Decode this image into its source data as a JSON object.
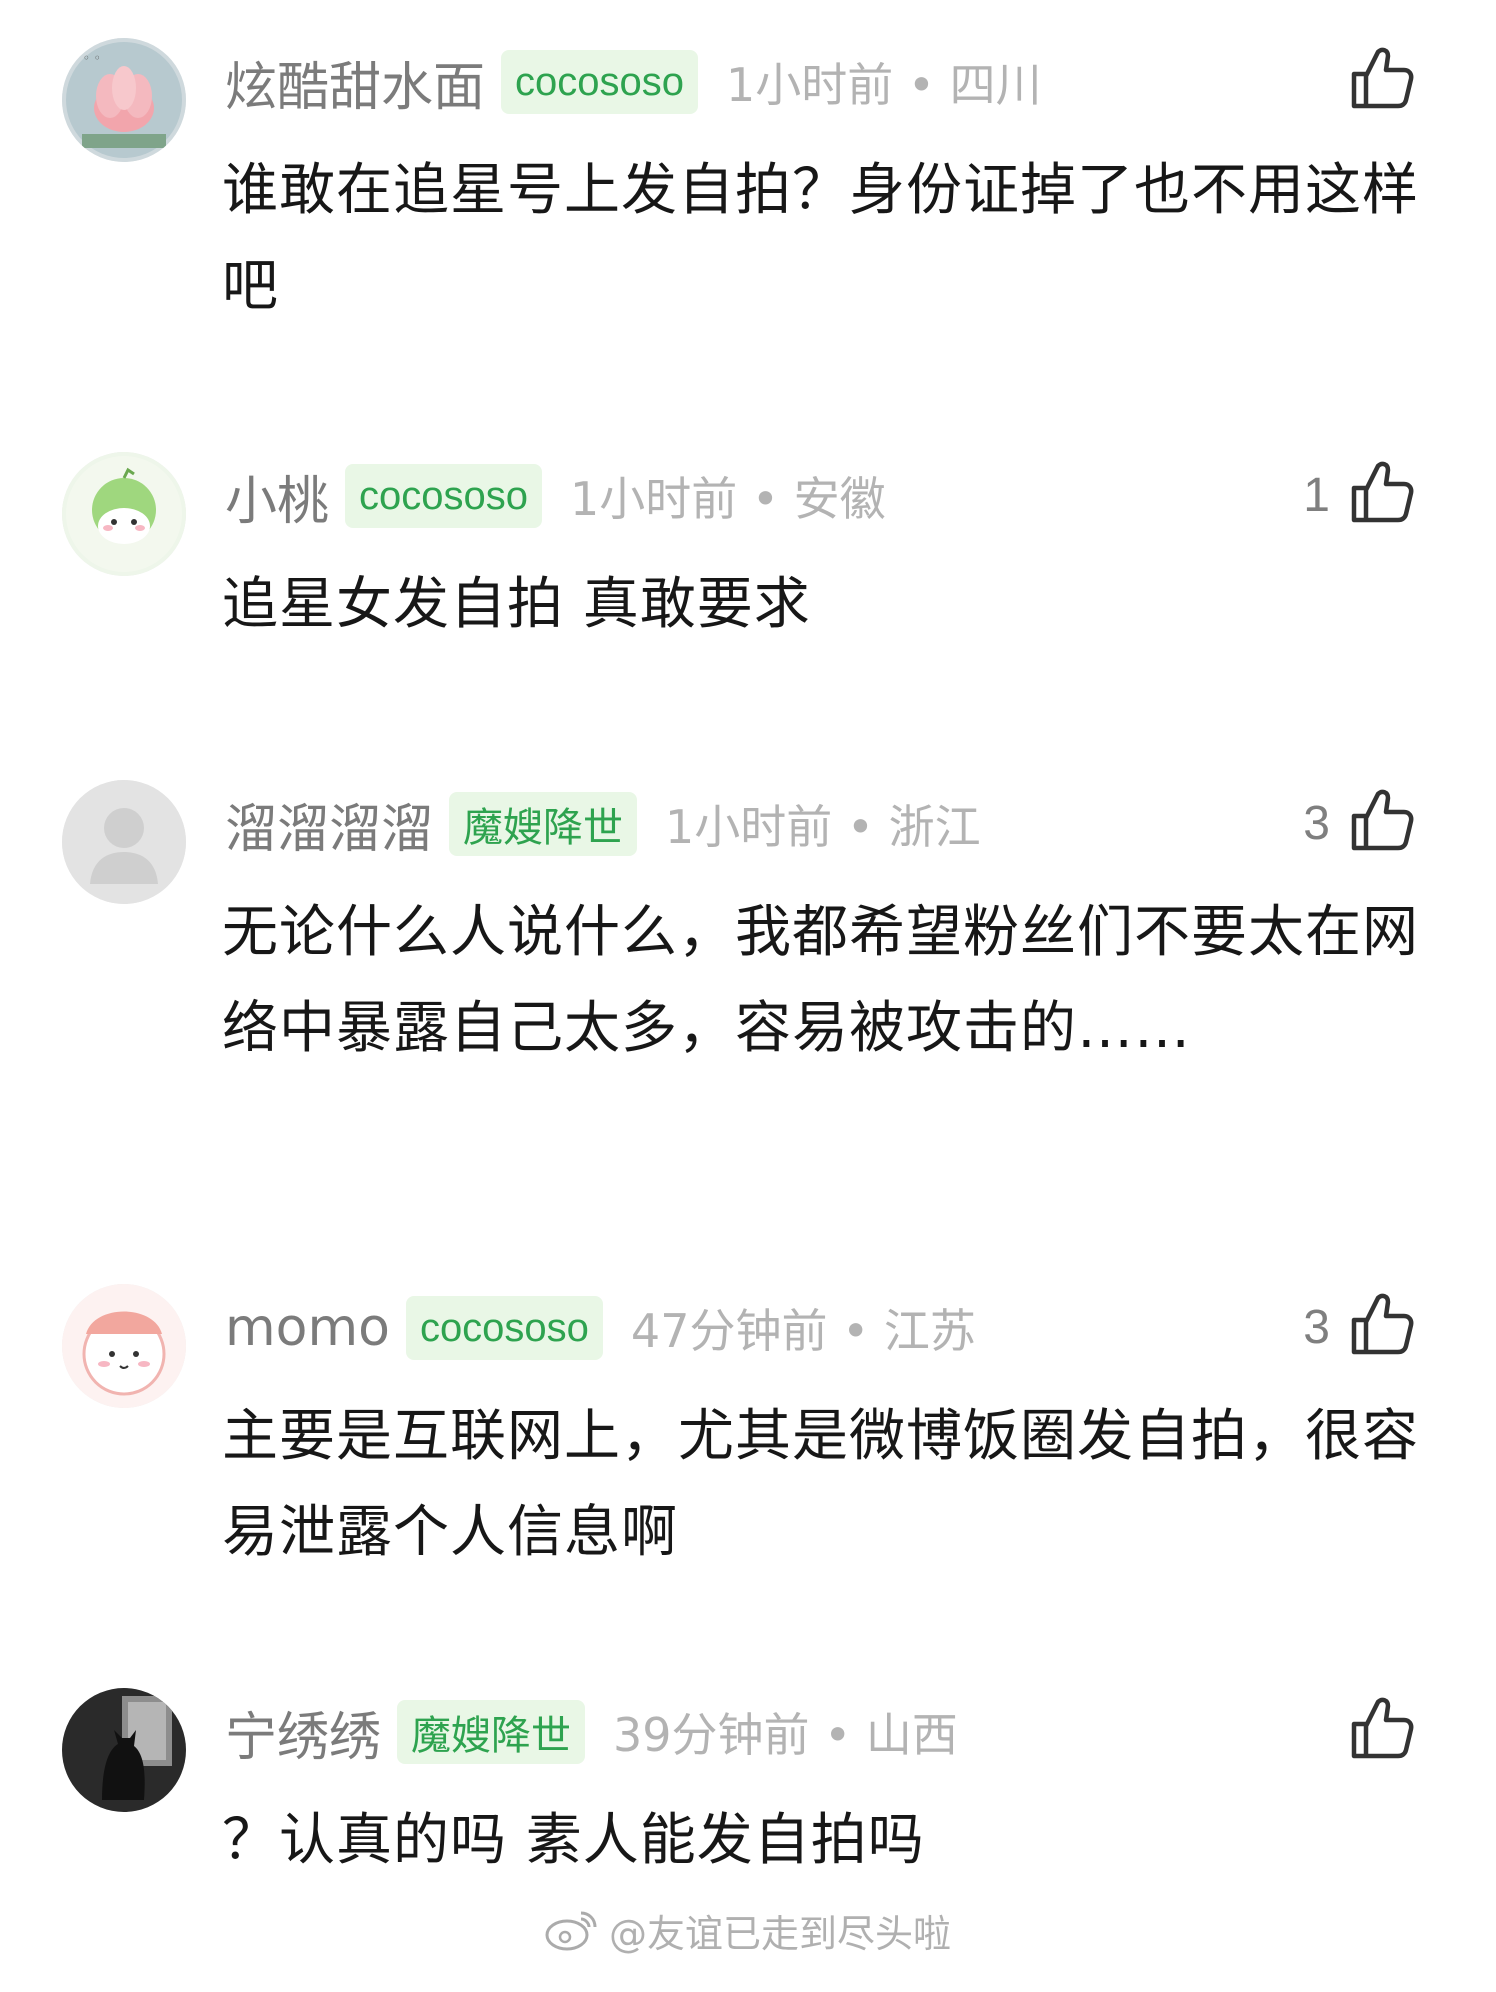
{
  "comments": [
    {
      "username": "炫酷甜水面",
      "badge": "cocososo",
      "meta": "1小时前 • 四川",
      "likes": "",
      "text": "谁敢在追星号上发自拍？身份证掉了也不用这样吧"
    },
    {
      "username": "小桃",
      "badge": "cocososo",
      "meta": "1小时前 • 安徽",
      "likes": "1",
      "text": "追星女发自拍 真敢要求"
    },
    {
      "username": "溜溜溜溜",
      "badge": "魔嫂降世",
      "meta": "1小时前 • 浙江",
      "likes": "3",
      "text": "无论什么人说什么，我都希望粉丝们不要太在网络中暴露自己太多，容易被攻击的……"
    },
    {
      "username": "momo",
      "badge": "cocososo",
      "meta": "47分钟前 • 江苏",
      "likes": "3",
      "text": "主要是互联网上，尤其是微博饭圈发自拍，很容易泄露个人信息啊"
    },
    {
      "username": "宁绣绣",
      "badge": "魔嫂降世",
      "meta": "39分钟前 • 山西",
      "likes": "",
      "text": "？认真的吗 素人能发自拍吗"
    }
  ],
  "watermark": "@友谊已走到尽头啦",
  "icons": {
    "like": "thumbs-up-icon",
    "watermark_logo": "weibo-logo-icon"
  },
  "colors": {
    "badge_bg": "#e9f7e6",
    "badge_text": "#2ea34f",
    "meta": "#b3b3b3",
    "username": "#7b7b7b",
    "body_text": "#171717"
  }
}
